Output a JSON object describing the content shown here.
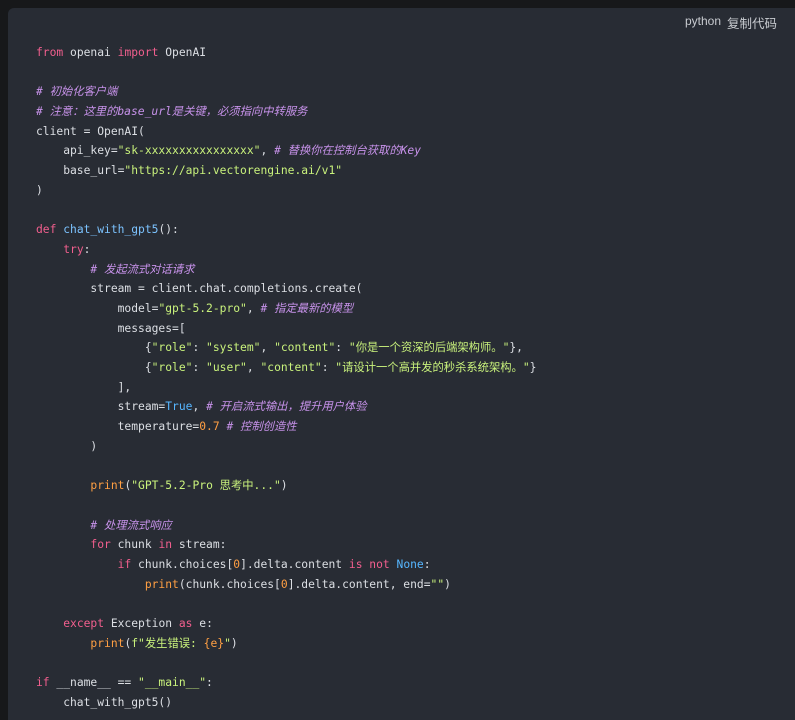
{
  "header": {
    "language": "python",
    "copy_label": "复制代码"
  },
  "code": {
    "lines": [
      [
        [
          "kw",
          "from"
        ],
        [
          "t",
          " openai "
        ],
        [
          "kw",
          "import"
        ],
        [
          "t",
          " OpenAI"
        ]
      ],
      [],
      [
        [
          "com",
          "# 初始化客户端"
        ]
      ],
      [
        [
          "com",
          "# 注意：这里的base_url是关键，必须指向中转服务"
        ]
      ],
      [
        [
          "t",
          "client = OpenAI("
        ]
      ],
      [
        [
          "t",
          "    api_key="
        ],
        [
          "str",
          "\"sk-xxxxxxxxxxxxxxxx\""
        ],
        [
          "t",
          ", "
        ],
        [
          "com",
          "# 替换你在控制台获取的Key"
        ]
      ],
      [
        [
          "t",
          "    base_url="
        ],
        [
          "str",
          "\"https://api.vectorengine.ai/v1\""
        ]
      ],
      [
        [
          "t",
          ")"
        ]
      ],
      [],
      [
        [
          "kw",
          "def"
        ],
        [
          "t",
          " "
        ],
        [
          "fn",
          "chat_with_gpt5"
        ],
        [
          "t",
          "():"
        ]
      ],
      [
        [
          "t",
          "    "
        ],
        [
          "kw",
          "try"
        ],
        [
          "t",
          ":"
        ]
      ],
      [
        [
          "t",
          "        "
        ],
        [
          "com",
          "# 发起流式对话请求"
        ]
      ],
      [
        [
          "t",
          "        stream = client.chat.completions.create("
        ]
      ],
      [
        [
          "t",
          "            model="
        ],
        [
          "str",
          "\"gpt-5.2-pro\""
        ],
        [
          "t",
          ", "
        ],
        [
          "com",
          "# 指定最新的模型"
        ]
      ],
      [
        [
          "t",
          "            messages=["
        ]
      ],
      [
        [
          "t",
          "                {"
        ],
        [
          "str",
          "\"role\""
        ],
        [
          "t",
          ": "
        ],
        [
          "str",
          "\"system\""
        ],
        [
          "t",
          ", "
        ],
        [
          "str",
          "\"content\""
        ],
        [
          "t",
          ": "
        ],
        [
          "str",
          "\"你是一个资深的后端架构师。\""
        ],
        [
          "t",
          "},"
        ]
      ],
      [
        [
          "t",
          "                {"
        ],
        [
          "str",
          "\"role\""
        ],
        [
          "t",
          ": "
        ],
        [
          "str",
          "\"user\""
        ],
        [
          "t",
          ", "
        ],
        [
          "str",
          "\"content\""
        ],
        [
          "t",
          ": "
        ],
        [
          "str",
          "\"请设计一个高并发的秒杀系统架构。\""
        ],
        [
          "t",
          "}"
        ]
      ],
      [
        [
          "t",
          "            ],"
        ]
      ],
      [
        [
          "t",
          "            stream="
        ],
        [
          "cn",
          "True"
        ],
        [
          "t",
          ", "
        ],
        [
          "com",
          "# 开启流式输出，提升用户体验"
        ]
      ],
      [
        [
          "t",
          "            temperature="
        ],
        [
          "num",
          "0.7"
        ],
        [
          "t",
          " "
        ],
        [
          "com",
          "# 控制创造性"
        ]
      ],
      [
        [
          "t",
          "        )"
        ]
      ],
      [],
      [
        [
          "t",
          "        "
        ],
        [
          "bi",
          "print"
        ],
        [
          "t",
          "("
        ],
        [
          "str",
          "\"GPT-5.2-Pro 思考中...\""
        ],
        [
          "t",
          ")"
        ]
      ],
      [],
      [
        [
          "t",
          "        "
        ],
        [
          "com",
          "# 处理流式响应"
        ]
      ],
      [
        [
          "t",
          "        "
        ],
        [
          "kw",
          "for"
        ],
        [
          "t",
          " chunk "
        ],
        [
          "kw",
          "in"
        ],
        [
          "t",
          " stream:"
        ]
      ],
      [
        [
          "t",
          "            "
        ],
        [
          "kw",
          "if"
        ],
        [
          "t",
          " chunk.choices["
        ],
        [
          "num",
          "0"
        ],
        [
          "t",
          "].delta.content "
        ],
        [
          "kw",
          "is not"
        ],
        [
          "t",
          " "
        ],
        [
          "cn",
          "None"
        ],
        [
          "t",
          ":"
        ]
      ],
      [
        [
          "t",
          "                "
        ],
        [
          "bi",
          "print"
        ],
        [
          "t",
          "(chunk.choices["
        ],
        [
          "num",
          "0"
        ],
        [
          "t",
          "].delta.content, end="
        ],
        [
          "str",
          "\"\""
        ],
        [
          "t",
          ")"
        ]
      ],
      [],
      [
        [
          "t",
          "    "
        ],
        [
          "kw",
          "except"
        ],
        [
          "t",
          " Exception "
        ],
        [
          "kw",
          "as"
        ],
        [
          "t",
          " e:"
        ]
      ],
      [
        [
          "t",
          "        "
        ],
        [
          "bi",
          "print"
        ],
        [
          "t",
          "("
        ],
        [
          "str",
          "f\"发生错误: "
        ],
        [
          "num",
          "{e}"
        ],
        [
          "str",
          "\""
        ],
        [
          "t",
          ")"
        ]
      ],
      [],
      [
        [
          "kw",
          "if"
        ],
        [
          "t",
          " __name__ == "
        ],
        [
          "str",
          "\"__main__\""
        ],
        [
          "t",
          ":"
        ]
      ],
      [
        [
          "t",
          "    chat_with_gpt5()"
        ]
      ]
    ]
  },
  "colors": {
    "background": "#282c34",
    "keyword": "#f25f8e",
    "function": "#7cc3ff",
    "builtin": "#ff9f43",
    "string": "#c9f27c",
    "comment": "#c792ea",
    "constant": "#56b6ff"
  }
}
